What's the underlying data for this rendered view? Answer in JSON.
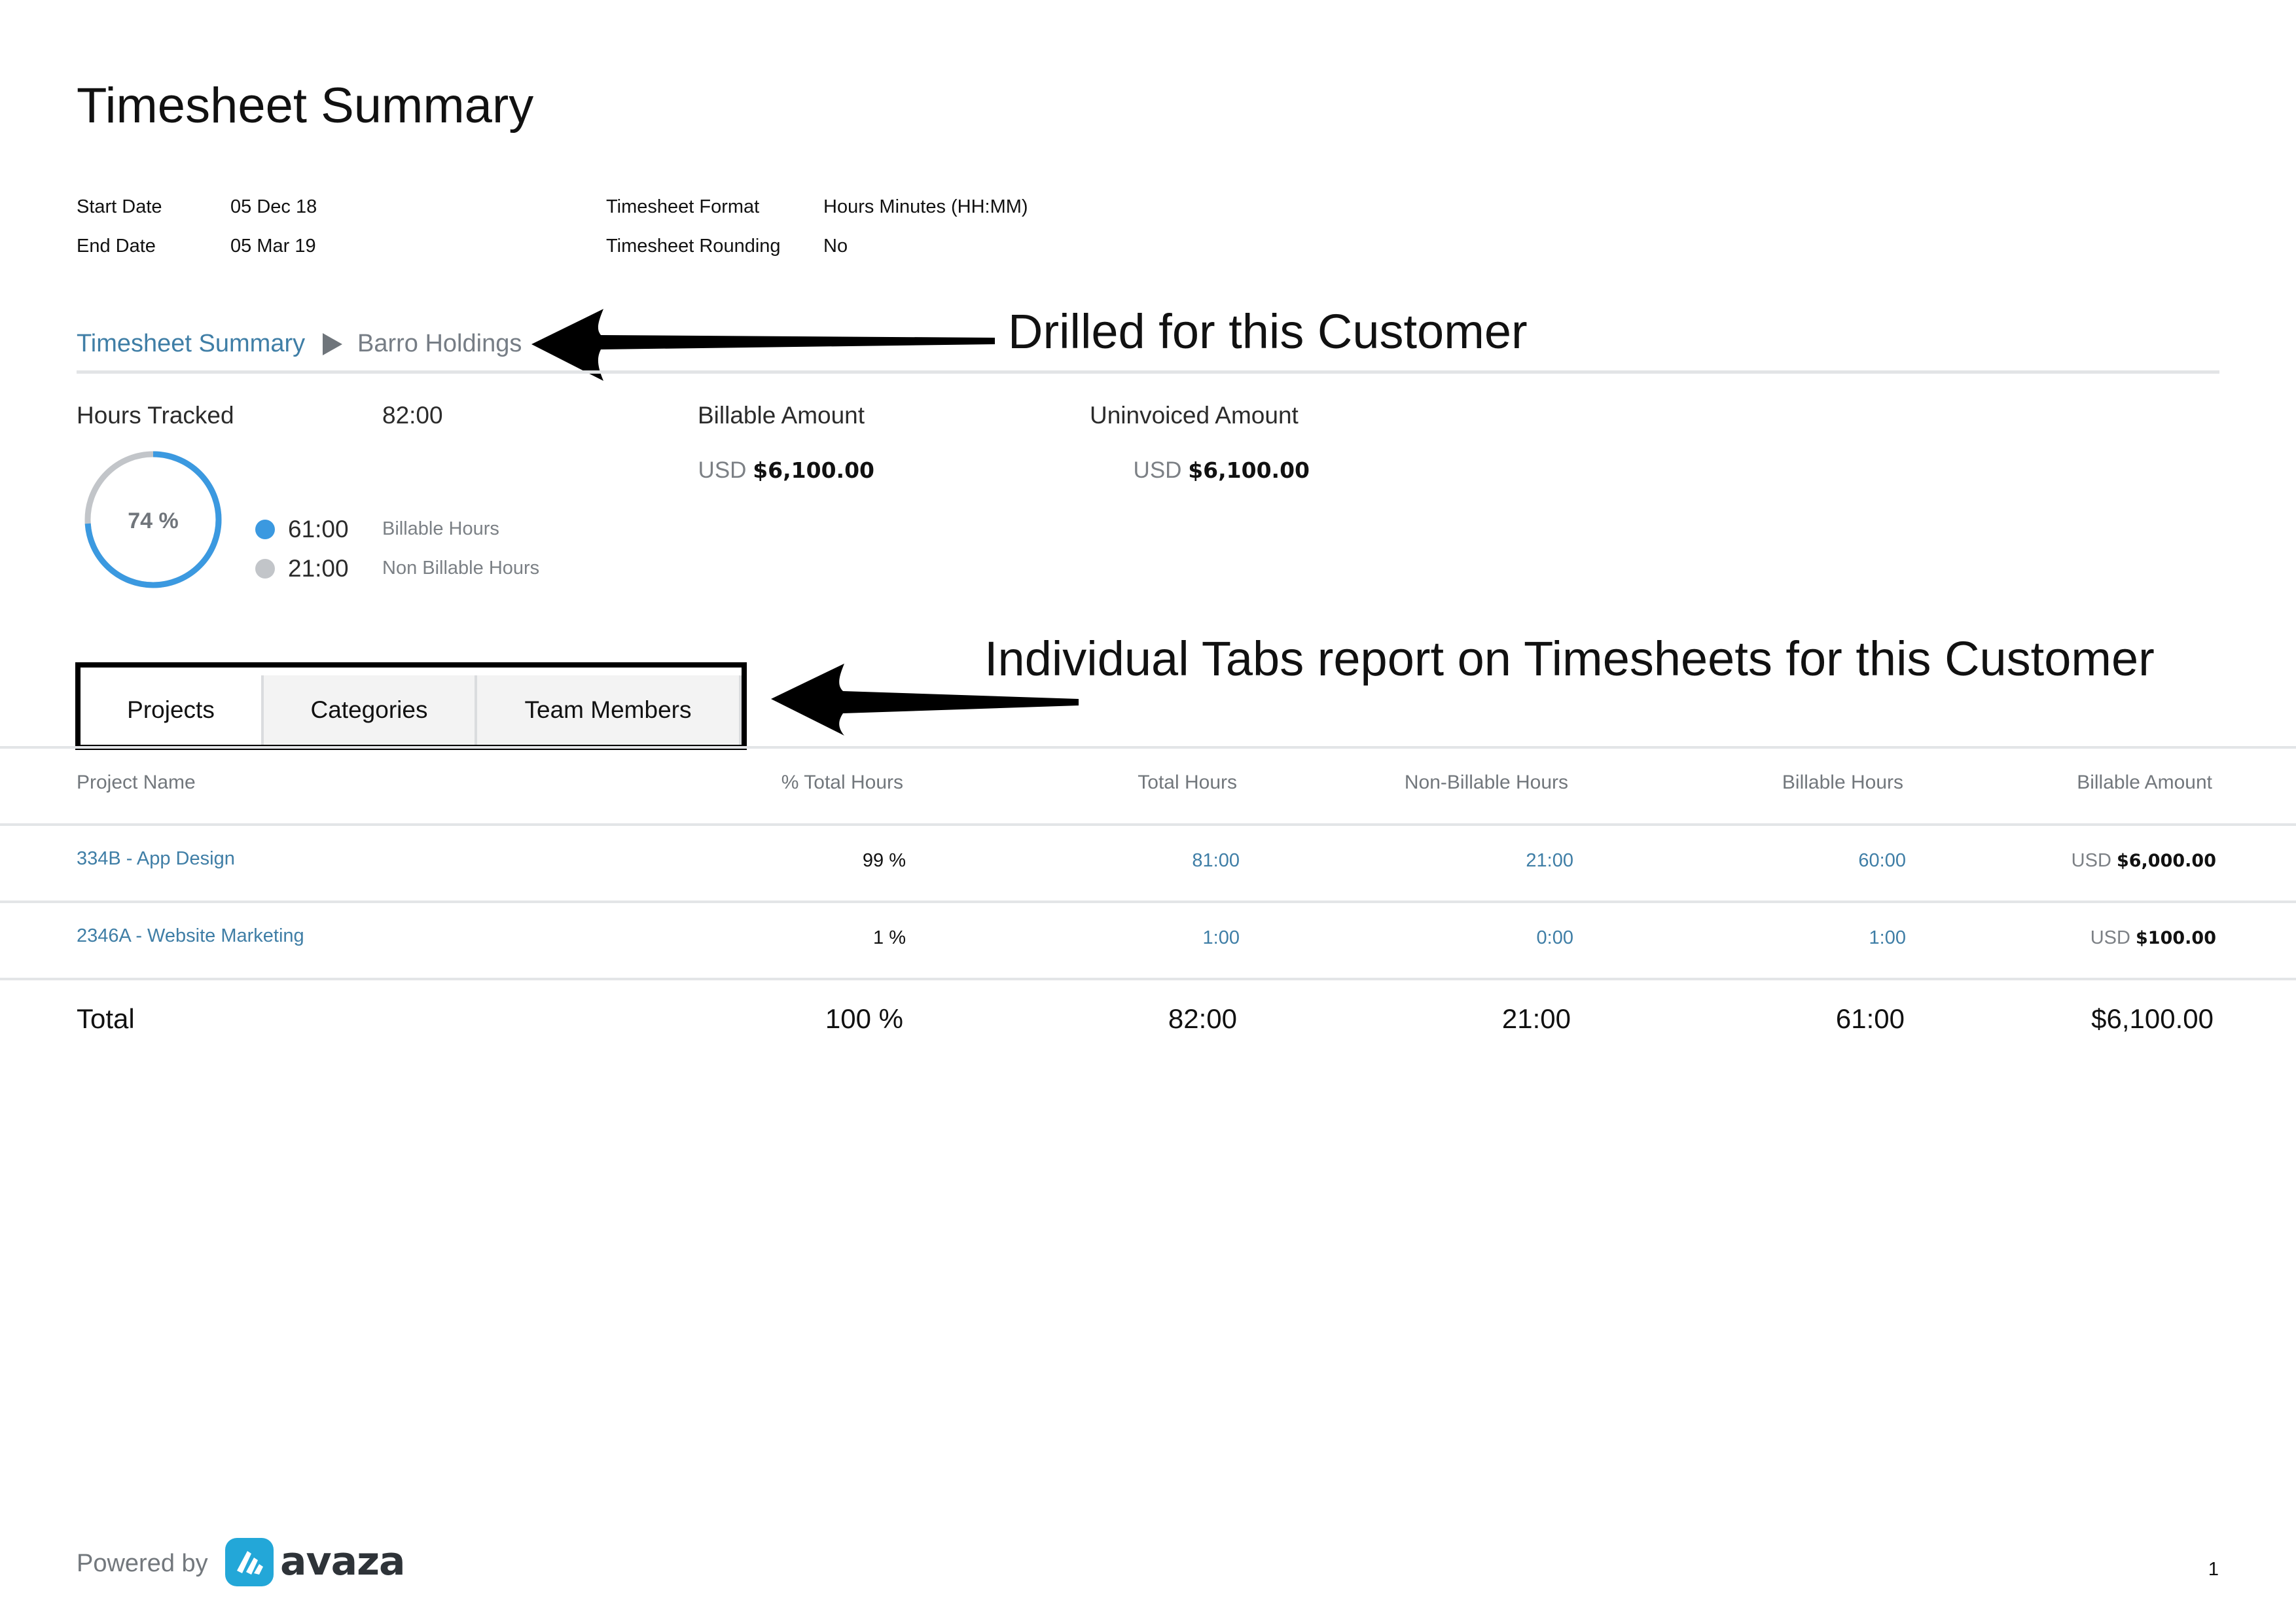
{
  "title": "Timesheet Summary",
  "meta": {
    "start_date_label": "Start Date",
    "start_date_value": "05 Dec 18",
    "end_date_label": "End Date",
    "end_date_value": "05 Mar 19",
    "format_label": "Timesheet Format",
    "format_value": "Hours Minutes (HH:MM)",
    "rounding_label": "Timesheet Rounding",
    "rounding_value": "No"
  },
  "breadcrumb": {
    "root": "Timesheet Summary",
    "current": "Barro Holdings"
  },
  "annotations": {
    "drill": "Drilled for this Customer",
    "tabs": "Individual Tabs report on Timesheets for this Customer"
  },
  "summary": {
    "hours_tracked_label": "Hours Tracked",
    "hours_tracked_value": "82:00",
    "billable_amount_label": "Billable Amount",
    "billable_amount_currency": "USD",
    "billable_amount_value": "$6,100.00",
    "uninvoiced_amount_label": "Uninvoiced Amount",
    "uninvoiced_amount_currency": "USD",
    "uninvoiced_amount_value": "$6,100.00",
    "donut_percent_label": "74 %",
    "donut_billable_fraction": 0.74,
    "billable_hours_value": "61:00",
    "billable_hours_label": "Billable Hours",
    "non_billable_hours_value": "21:00",
    "non_billable_hours_label": "Non Billable Hours",
    "billable_color": "#3b99e0",
    "non_billable_color": "#c2c5c9"
  },
  "tabs": [
    {
      "label": "Projects",
      "active": true
    },
    {
      "label": "Categories",
      "active": false
    },
    {
      "label": "Team Members",
      "active": false
    }
  ],
  "table": {
    "headers": [
      "Project Name",
      "% Total Hours",
      "Total Hours",
      "Non-Billable Hours",
      "Billable Hours",
      "Billable Amount"
    ],
    "rows": [
      {
        "name": "334B - App Design",
        "percent": "99 %",
        "total": "81:00",
        "non_billable": "21:00",
        "billable": "60:00",
        "currency": "USD",
        "amount": "$6,000.00"
      },
      {
        "name": "2346A - Website Marketing",
        "percent": "1 %",
        "total": "1:00",
        "non_billable": "0:00",
        "billable": "1:00",
        "currency": "USD",
        "amount": "$100.00"
      }
    ],
    "totals": {
      "label": "Total",
      "percent": "100 %",
      "total": "82:00",
      "non_billable": "21:00",
      "billable": "61:00",
      "amount": "$6,100.00"
    }
  },
  "footer": {
    "powered_by": "Powered by",
    "brand": "avaza",
    "page_number": "1"
  },
  "colors": {
    "link": "#3f7ea6",
    "brand": "#23a7d8"
  }
}
